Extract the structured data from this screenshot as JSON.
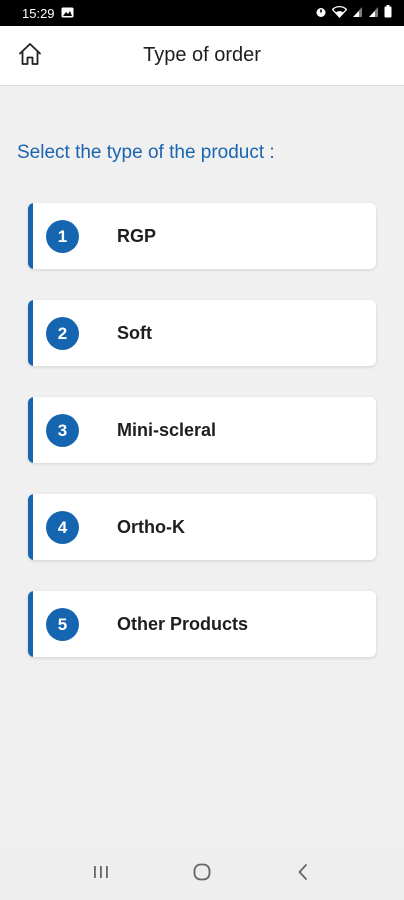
{
  "status_bar": {
    "time": "15:29",
    "icons": [
      "image-icon",
      "alarm-icon",
      "wifi-icon",
      "signal-icon",
      "signal-icon",
      "battery-icon"
    ]
  },
  "header": {
    "title": "Type of order",
    "home_icon": "home-icon"
  },
  "prompt": "Select the type of the product :",
  "options": [
    {
      "number": "1",
      "label": "RGP"
    },
    {
      "number": "2",
      "label": "Soft"
    },
    {
      "number": "3",
      "label": "Mini-scleral"
    },
    {
      "number": "4",
      "label": "Ortho-K"
    },
    {
      "number": "5",
      "label": "Other Products"
    }
  ],
  "nav_bar": {
    "icons": [
      "recent-apps-icon",
      "home-circle-icon",
      "back-icon"
    ]
  },
  "colors": {
    "accent": "#1565b0",
    "prompt": "#1a65b0",
    "background": "#f0f0f1"
  }
}
